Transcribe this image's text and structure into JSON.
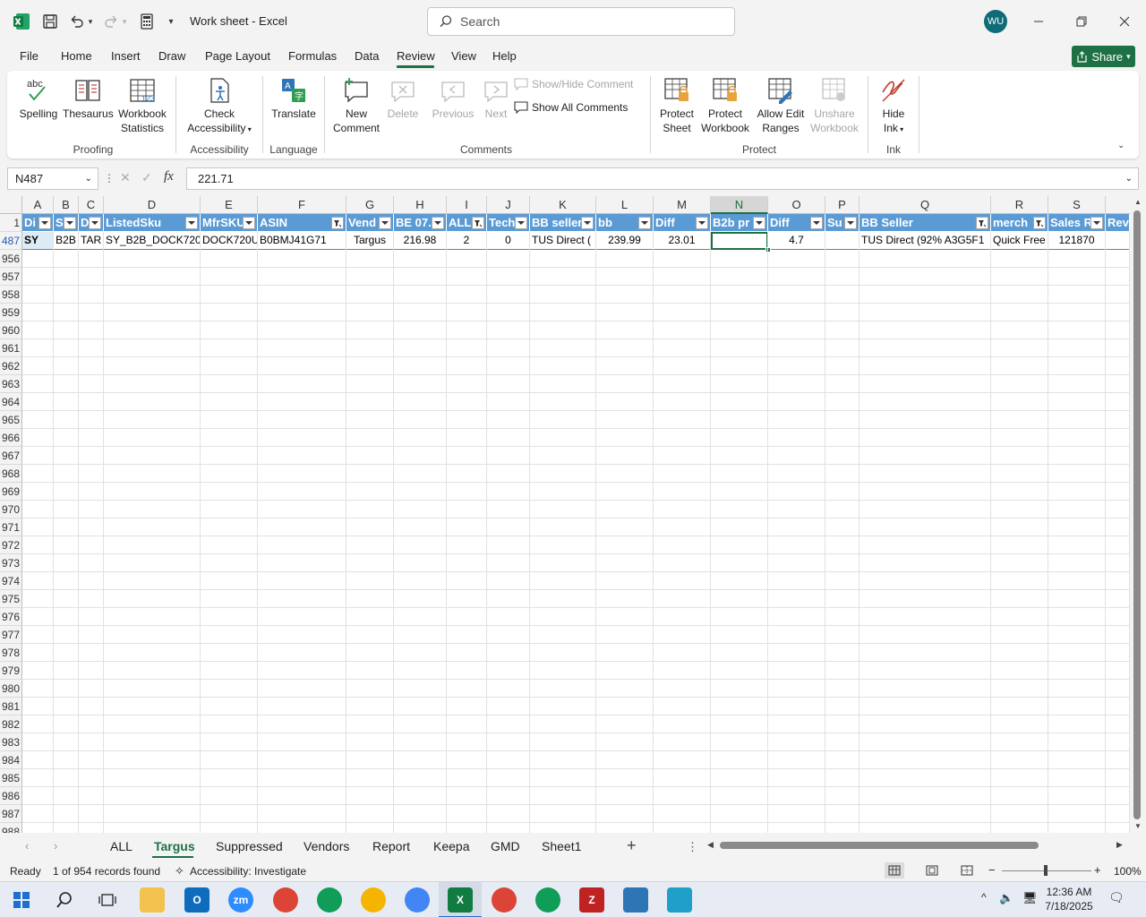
{
  "window": {
    "title": "Work sheet  -  Excel",
    "search_placeholder": "Search",
    "avatar_initials": "WU"
  },
  "menu": {
    "file": "File",
    "home": "Home",
    "insert": "Insert",
    "draw": "Draw",
    "page_layout": "Page Layout",
    "formulas": "Formulas",
    "data": "Data",
    "review": "Review",
    "view": "View",
    "help": "Help",
    "share": "Share"
  },
  "ribbon": {
    "spelling": "Spelling",
    "thesaurus": "Thesaurus",
    "workbook_statistics_1": "Workbook",
    "workbook_statistics_2": "Statistics",
    "check_accessibility_1": "Check",
    "check_accessibility_2": "Accessibility",
    "translate": "Translate",
    "new_comment_1": "New",
    "new_comment_2": "Comment",
    "delete": "Delete",
    "previous": "Previous",
    "next": "Next",
    "show_hide_comment": "Show/Hide Comment",
    "show_all_comments": "Show All Comments",
    "protect_sheet_1": "Protect",
    "protect_sheet_2": "Sheet",
    "protect_workbook_1": "Protect",
    "protect_workbook_2": "Workbook",
    "allow_edit_1": "Allow Edit",
    "allow_edit_2": "Ranges",
    "unshare_1": "Unshare",
    "unshare_2": "Workbook",
    "hide_ink_1": "Hide",
    "hide_ink_2": "Ink",
    "groups": {
      "proofing": "Proofing",
      "accessibility": "Accessibility",
      "language": "Language",
      "comments": "Comments",
      "protect": "Protect",
      "ink": "Ink"
    }
  },
  "formula_bar": {
    "name_box": "N487",
    "value": "221.71"
  },
  "columns": [
    "A",
    "B",
    "C",
    "D",
    "E",
    "F",
    "G",
    "H",
    "I",
    "J",
    "K",
    "L",
    "M",
    "N",
    "O",
    "P",
    "Q",
    "R",
    "S"
  ],
  "header_row": {
    "row_num": "1",
    "cells": [
      "Di",
      "S",
      "D",
      "ListedSku",
      "MfrSKU",
      "ASIN",
      "Vend",
      "BE 07.",
      "ALL",
      "Tech",
      "BB seller",
      "bb",
      "Diff",
      "B2b pr",
      "Diff",
      "Su",
      "BB Seller",
      "merch",
      "Sales R",
      "Rev"
    ]
  },
  "data_row": {
    "row_num": "487",
    "cells": [
      "SY",
      "B2B",
      "TAR",
      "SY_B2B_DOCK720",
      "DOCK720U",
      "B0BMJ41G71",
      "Targus",
      "216.98",
      "2",
      "0",
      "TUS Direct (",
      "239.99",
      "23.01",
      "",
      "4.7",
      "",
      "TUS Direct (92% A3G5F1",
      "Quick Free",
      "121870",
      ""
    ]
  },
  "row_numbers": [
    "956",
    "957",
    "958",
    "959",
    "960",
    "961",
    "962",
    "963",
    "964",
    "965",
    "966",
    "967",
    "968",
    "969",
    "970",
    "971",
    "972",
    "973",
    "974",
    "975",
    "976",
    "977",
    "978",
    "979",
    "980",
    "981",
    "982",
    "983",
    "984",
    "985",
    "986",
    "987",
    "988"
  ],
  "sheets": [
    "ALL",
    "Targus",
    "Suppressed",
    "Vendors",
    "Report",
    "Keepa",
    "GMD",
    "Sheet1"
  ],
  "active_sheet": "Targus",
  "status": {
    "ready": "Ready",
    "records": "1 of 954 records found",
    "accessibility": "Accessibility: Investigate",
    "zoom": "100%"
  },
  "clock": {
    "time": "12:36 AM",
    "date": "7/18/2025"
  },
  "colors": {
    "excel_green": "#1e7145",
    "header_fill": "#5b9bd5"
  }
}
